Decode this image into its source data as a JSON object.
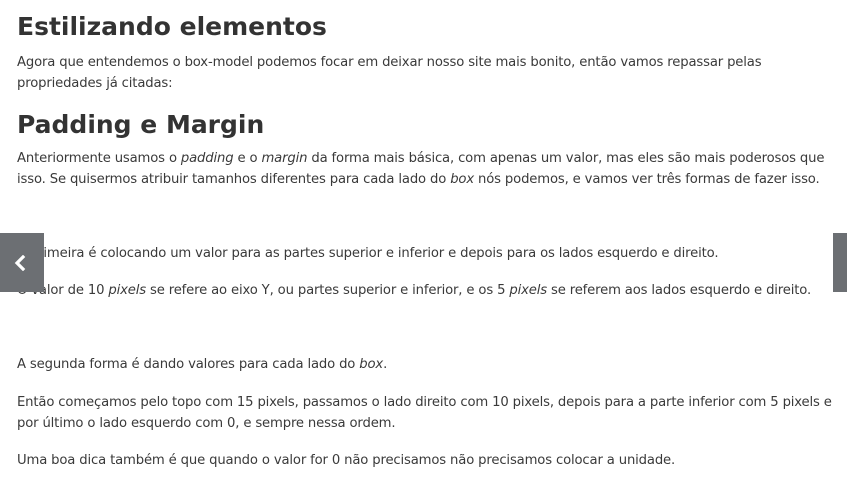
{
  "section1": {
    "title": "Estilizando elementos",
    "intro": "Agora que entendemos o box-model podemos focar em deixar nosso site mais bonito, então vamos repassar pelas propriedades já citadas:"
  },
  "section2": {
    "title": "Padding e Margin",
    "p1": {
      "t1": "Anteriormente usamos o ",
      "e1": "padding",
      "t2": " e o ",
      "e2": "margin",
      "t3": " da forma mais básica, com apenas um valor, mas eles são mais poderosos que isso. Se quisermos atribuir tamanhos diferentes para cada lado do ",
      "e3": "box",
      "t4": " nós podemos, e vamos ver três formas de fazer isso."
    },
    "p2": "A primeira é colocando um valor para as partes superior e inferior e depois para os lados esquerdo e direito.",
    "p3": {
      "t1": "O valor de 10 ",
      "e1": "pixels",
      "t2": " se refere ao eixo Y, ou partes superior e inferior, e os 5 ",
      "e2": "pixels",
      "t3": " se referem aos lados esquerdo e direito."
    },
    "p4": {
      "t1": "A segunda forma é dando valores para cada lado do ",
      "e1": "box",
      "t2": "."
    },
    "p5": "Então começamos pelo topo com 15 pixels, passamos o lado direito com 10 pixels, depois para a parte inferior com 5 pixels e por último o lado esquerdo com 0, e sempre nessa ordem.",
    "p6": "Uma boa dica também é que quando o valor for 0 não precisamos não precisamos colocar a unidade."
  },
  "nav": {
    "prev_icon": "chevron-left-icon",
    "next_icon": "chevron-right-icon",
    "color": "#6c6f73"
  }
}
